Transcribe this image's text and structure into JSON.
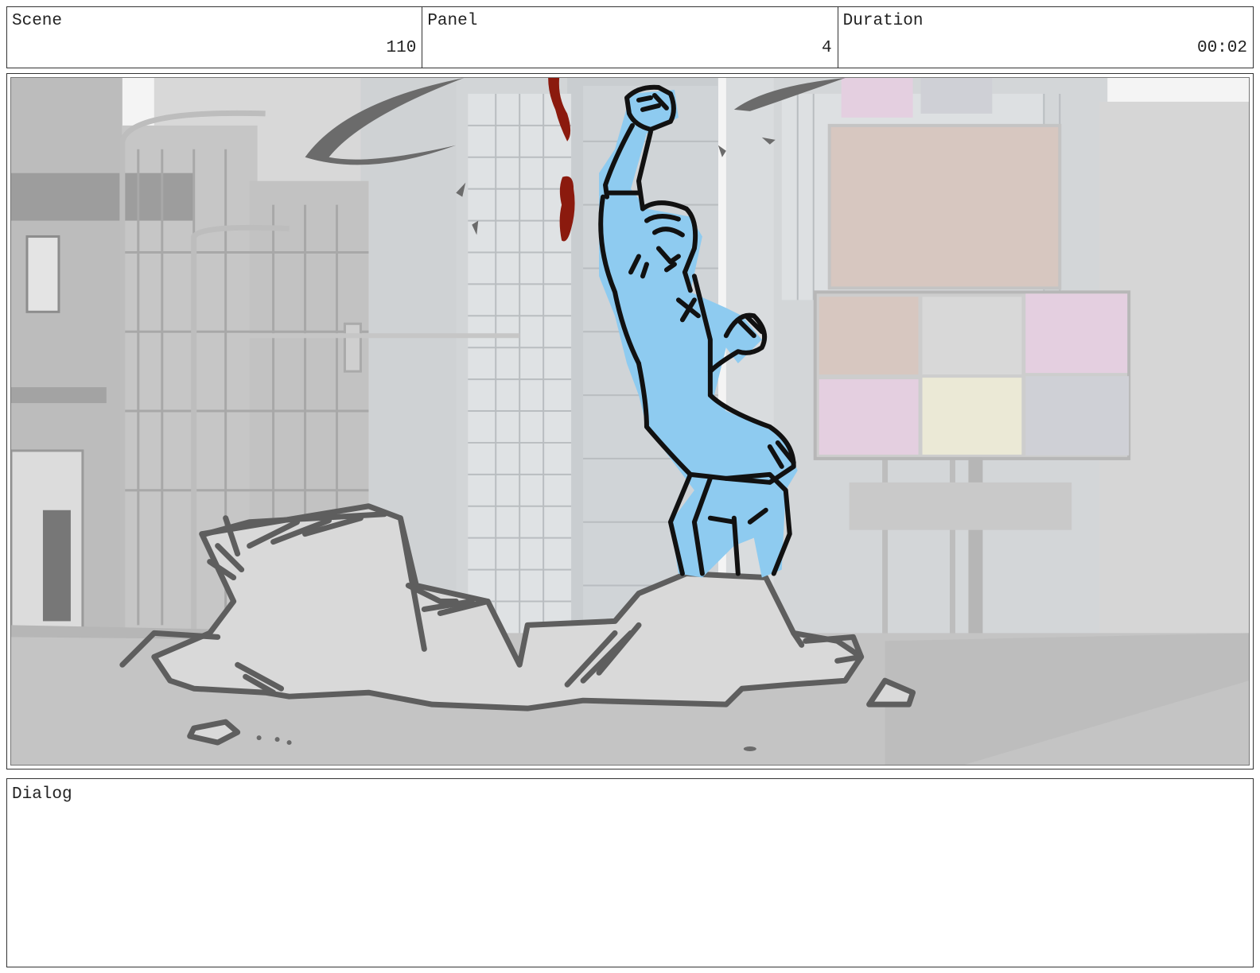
{
  "header": {
    "scene": {
      "label": "Scene",
      "value": "110"
    },
    "panel": {
      "label": "Panel",
      "value": "4"
    },
    "duration": {
      "label": "Duration",
      "value": "00:02"
    }
  },
  "storyboard_panel": {
    "description_icon": "hero-smashing-through-street-icon",
    "colors": {
      "sky": "#f4f4f4",
      "building_light": "#dcdcdc",
      "building_mid": "#c9c9c9",
      "building_dark": "#b3b3b3",
      "window": "#e9ecee",
      "road": "#c4c4c4",
      "rubble": "#d9d9d9",
      "rubble_stroke": "#5e5e5e",
      "hero_fill": "#8ecbf0",
      "hero_stroke": "#111111",
      "blood": "#8b1a0e",
      "billboard_tan": "#d7c7c0",
      "billboard_pink": "#e4cfe0",
      "billboard_grey": "#cfd0d6",
      "billboard_yellow": "#ebe9d6"
    }
  },
  "dialog": {
    "label": "Dialog",
    "text": ""
  }
}
